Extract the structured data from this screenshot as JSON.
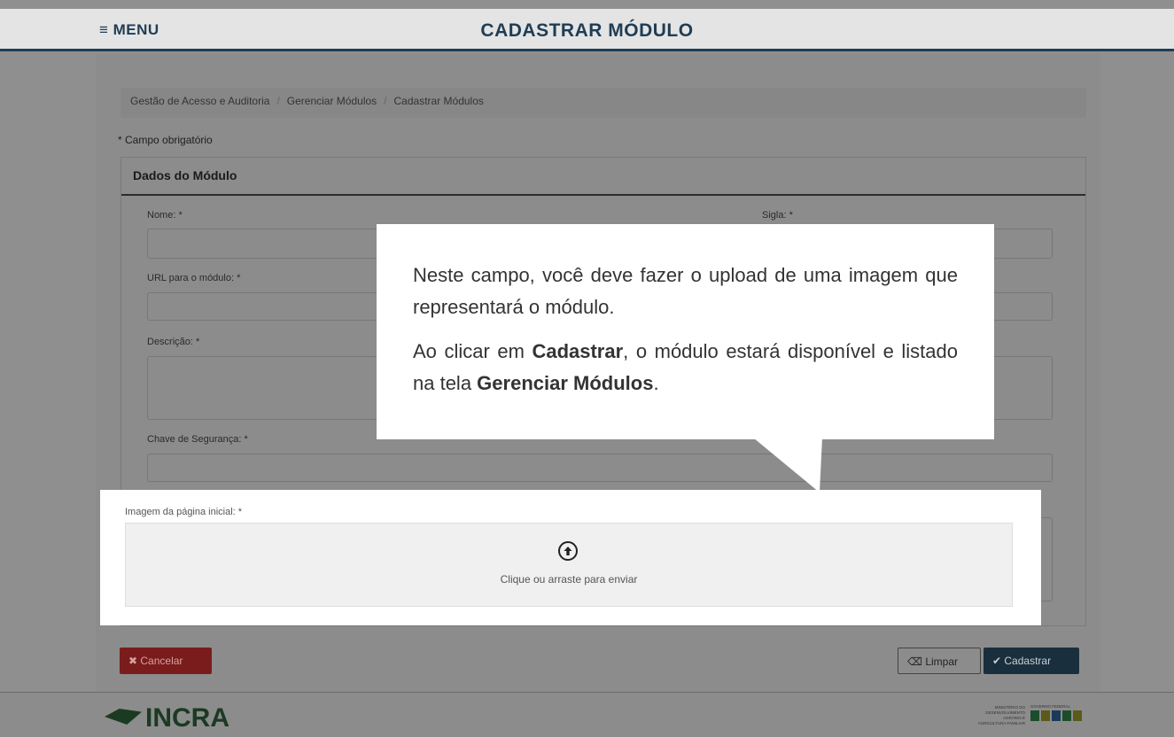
{
  "header": {
    "menu_label": "≡ MENU",
    "title": "CADASTRAR MÓDULO"
  },
  "breadcrumb": [
    "Gestão de Acesso e Auditoria",
    "Gerenciar Módulos",
    "Cadastrar Módulos"
  ],
  "required_note": "* Campo obrigatório",
  "form": {
    "section_title": "Dados do Módulo",
    "fields": {
      "nome": "Nome: *",
      "sigla": "Sigla: *",
      "url": "URL para o módulo: *",
      "descricao": "Descrição: *",
      "chave": "Chave de Segurança: *",
      "imagem": "Imagem da página inicial: *"
    },
    "upload_text": "Clique ou arraste para enviar"
  },
  "buttons": {
    "cancel": "✖ Cancelar",
    "clear": "Limpar",
    "submit": "✔ Cadastrar"
  },
  "callout": {
    "p1": "Neste campo, você deve fazer o upload de uma imagem que representará o módulo.",
    "p2_a": "Ao clicar em ",
    "p2_b": "Cadastrar",
    "p2_c": ", o módulo estará disponível e listado na tela ",
    "p2_d": "Gerenciar Módulos",
    "p2_e": "."
  },
  "footer": {
    "logo": "INCRA",
    "ministry": [
      "MINISTÉRIO DO",
      "DESENVOLVIMENTO",
      "AGRÁRIO E",
      "AGRICULTURA FAMILIAR"
    ],
    "gov_label": "GOVERNO FEDERAL",
    "brasil": "BRASIL"
  }
}
